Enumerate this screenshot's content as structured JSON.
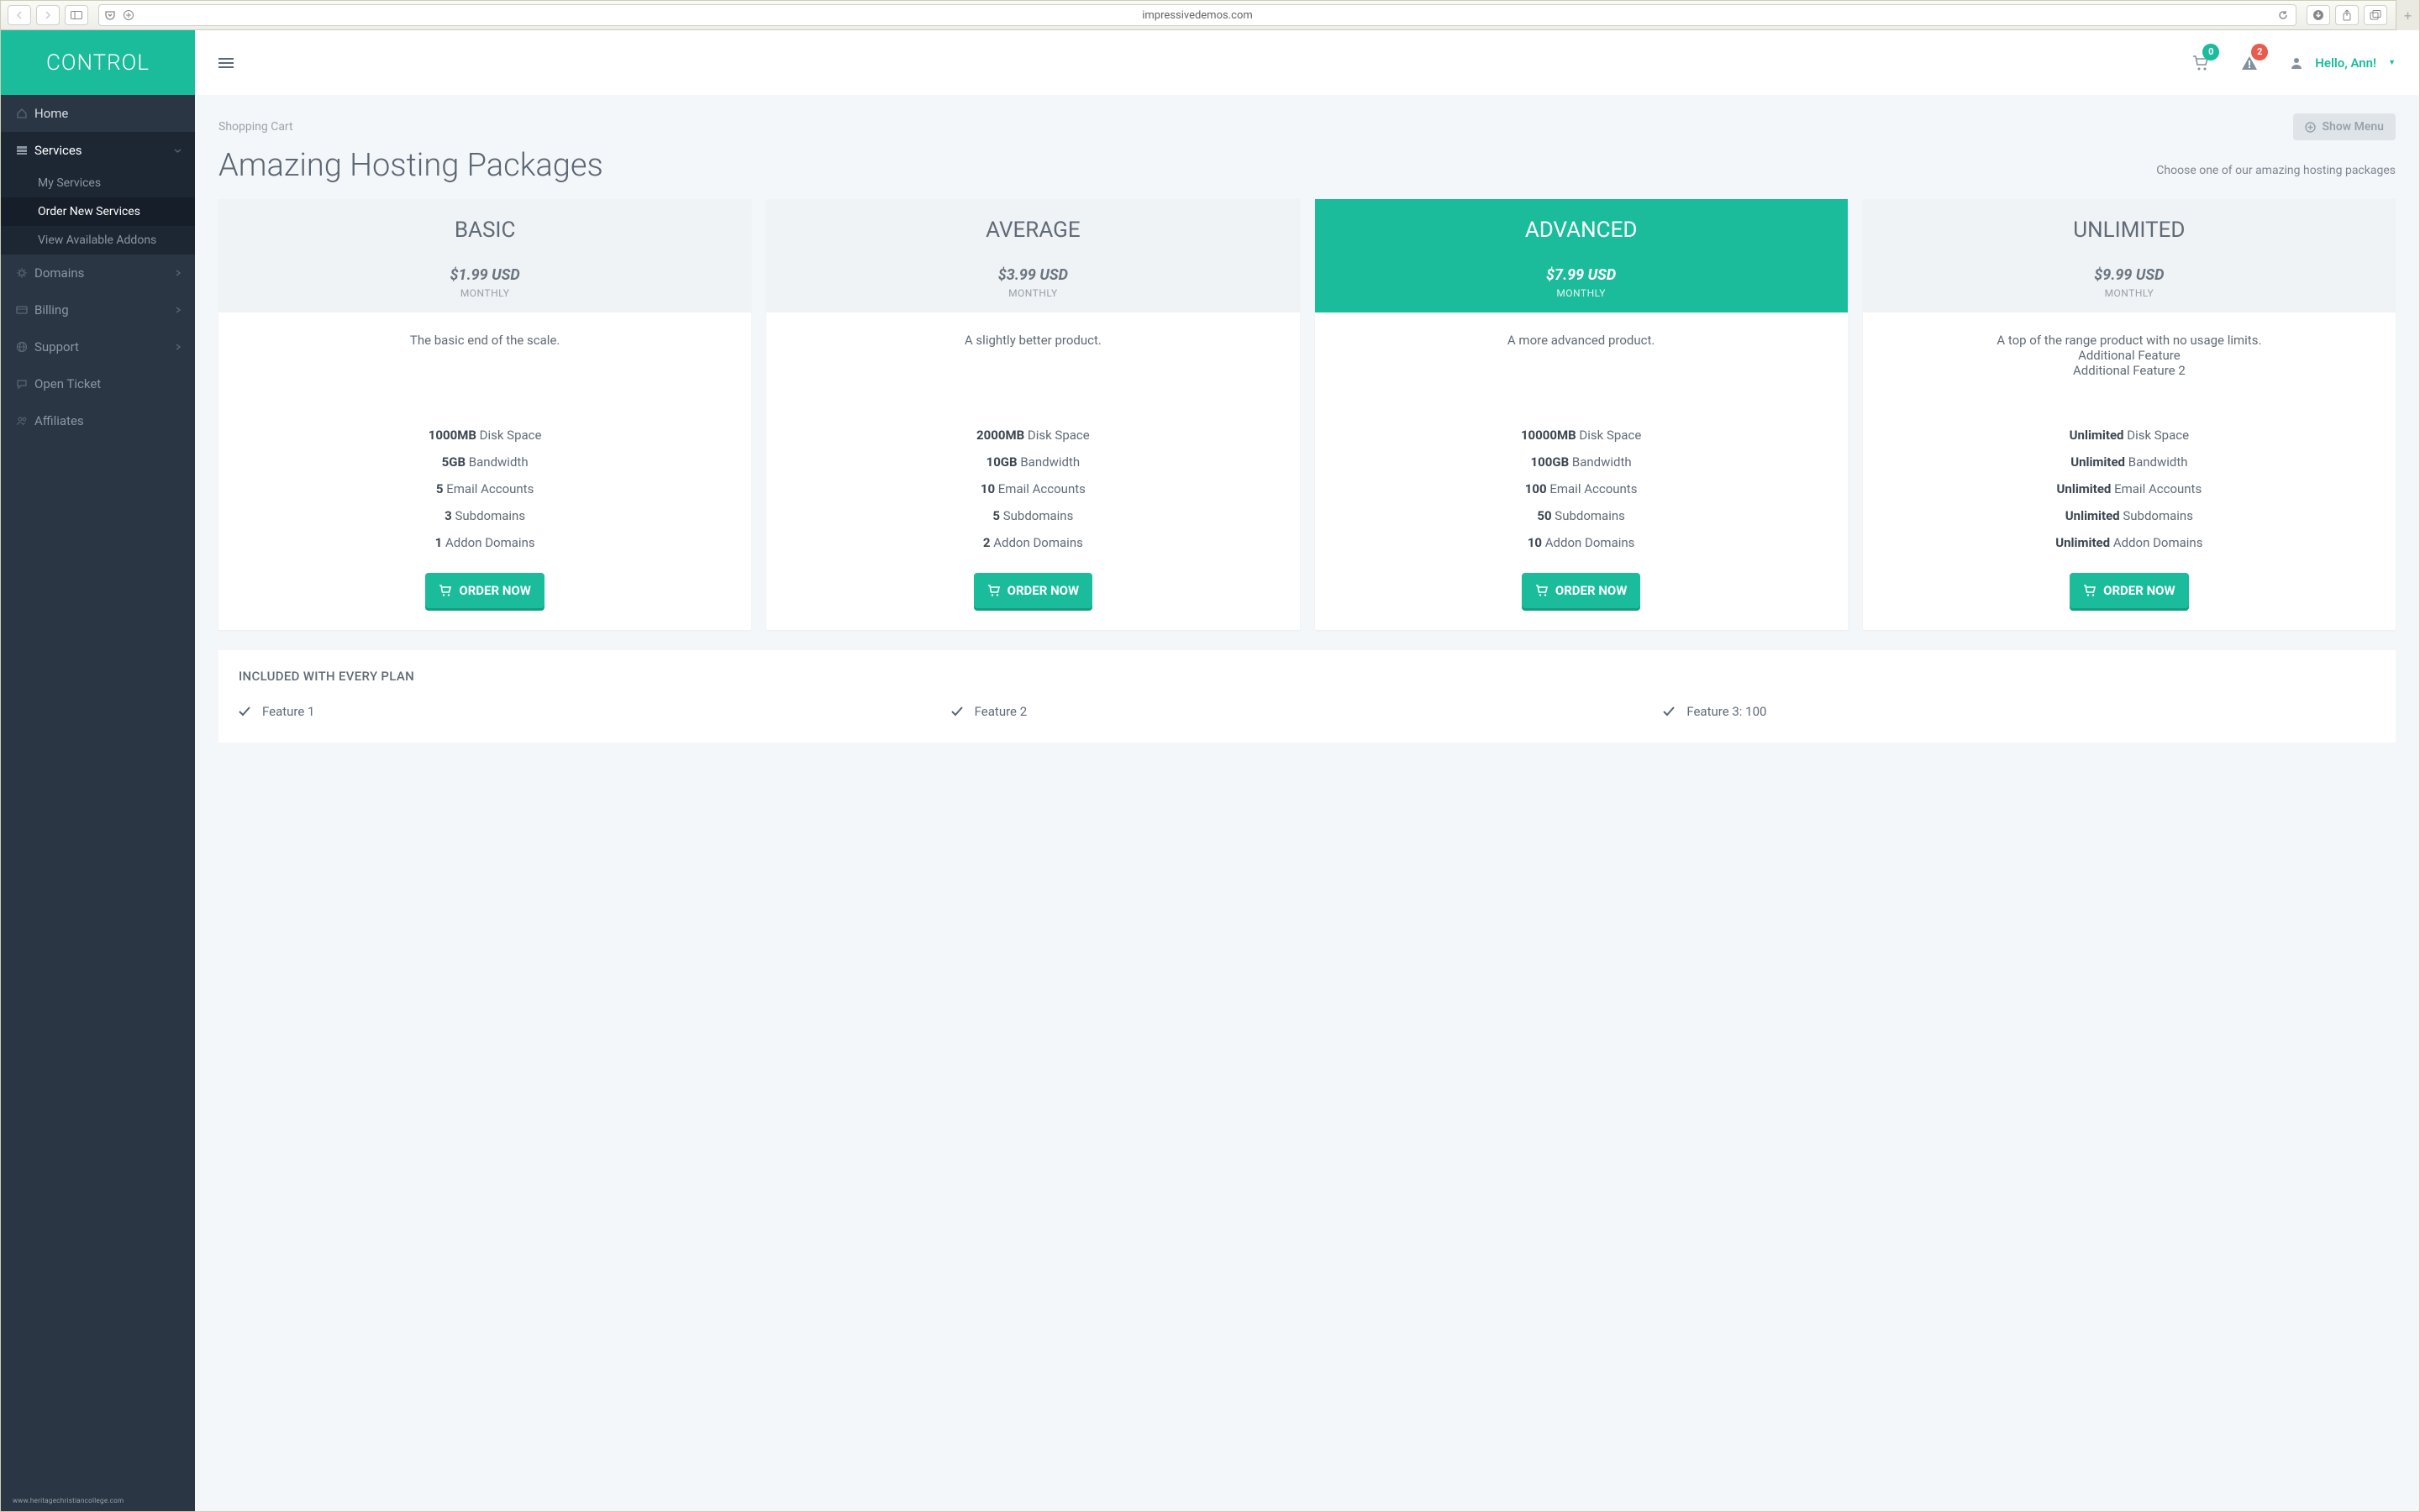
{
  "browser": {
    "url": "impressivedemos.com"
  },
  "brand": "CONTROL",
  "nav": {
    "home": "Home",
    "services": "Services",
    "services_sub": {
      "my": "My Services",
      "order": "Order New Services",
      "addons": "View Available Addons"
    },
    "domains": "Domains",
    "billing": "Billing",
    "support": "Support",
    "ticket": "Open Ticket",
    "affiliates": "Affiliates"
  },
  "topbar": {
    "cart_badge": "0",
    "alert_badge": "2",
    "greeting": "Hello, Ann!"
  },
  "page": {
    "crumb": "Shopping Cart",
    "show_menu": "Show Menu",
    "title": "Amazing Hosting Packages",
    "subtitle": "Choose one of our amazing hosting packages"
  },
  "plans": [
    {
      "name": "BASIC",
      "price": "$1.99 USD",
      "period": "MONTHLY",
      "desc": [
        "The basic end of the scale."
      ],
      "specs": [
        {
          "b": "1000MB",
          "t": "Disk Space"
        },
        {
          "b": "5GB",
          "t": "Bandwidth"
        },
        {
          "b": "5",
          "t": "Email Accounts"
        },
        {
          "b": "3",
          "t": "Subdomains"
        },
        {
          "b": "1",
          "t": "Addon Domains"
        }
      ],
      "featured": false
    },
    {
      "name": "AVERAGE",
      "price": "$3.99 USD",
      "period": "MONTHLY",
      "desc": [
        "A slightly better product."
      ],
      "specs": [
        {
          "b": "2000MB",
          "t": "Disk Space"
        },
        {
          "b": "10GB",
          "t": "Bandwidth"
        },
        {
          "b": "10",
          "t": "Email Accounts"
        },
        {
          "b": "5",
          "t": "Subdomains"
        },
        {
          "b": "2",
          "t": "Addon Domains"
        }
      ],
      "featured": false
    },
    {
      "name": "ADVANCED",
      "price": "$7.99 USD",
      "period": "MONTHLY",
      "desc": [
        "A more advanced product."
      ],
      "specs": [
        {
          "b": "10000MB",
          "t": "Disk Space"
        },
        {
          "b": "100GB",
          "t": "Bandwidth"
        },
        {
          "b": "100",
          "t": "Email Accounts"
        },
        {
          "b": "50",
          "t": "Subdomains"
        },
        {
          "b": "10",
          "t": "Addon Domains"
        }
      ],
      "featured": true
    },
    {
      "name": "UNLIMITED",
      "price": "$9.99 USD",
      "period": "MONTHLY",
      "desc": [
        "A top of the range product with no usage limits.",
        "Additional Feature",
        "Additional Feature 2"
      ],
      "specs": [
        {
          "b": "Unlimited",
          "t": "Disk Space"
        },
        {
          "b": "Unlimited",
          "t": "Bandwidth"
        },
        {
          "b": "Unlimited",
          "t": "Email Accounts"
        },
        {
          "b": "Unlimited",
          "t": "Subdomains"
        },
        {
          "b": "Unlimited",
          "t": "Addon Domains"
        }
      ],
      "featured": false
    }
  ],
  "order_label": "ORDER NOW",
  "included": {
    "heading": "INCLUDED WITH EVERY PLAN",
    "features": [
      "Feature 1",
      "Feature 2",
      "Feature 3: 100"
    ]
  },
  "watermark": "www.heritagechristiancollege.com"
}
